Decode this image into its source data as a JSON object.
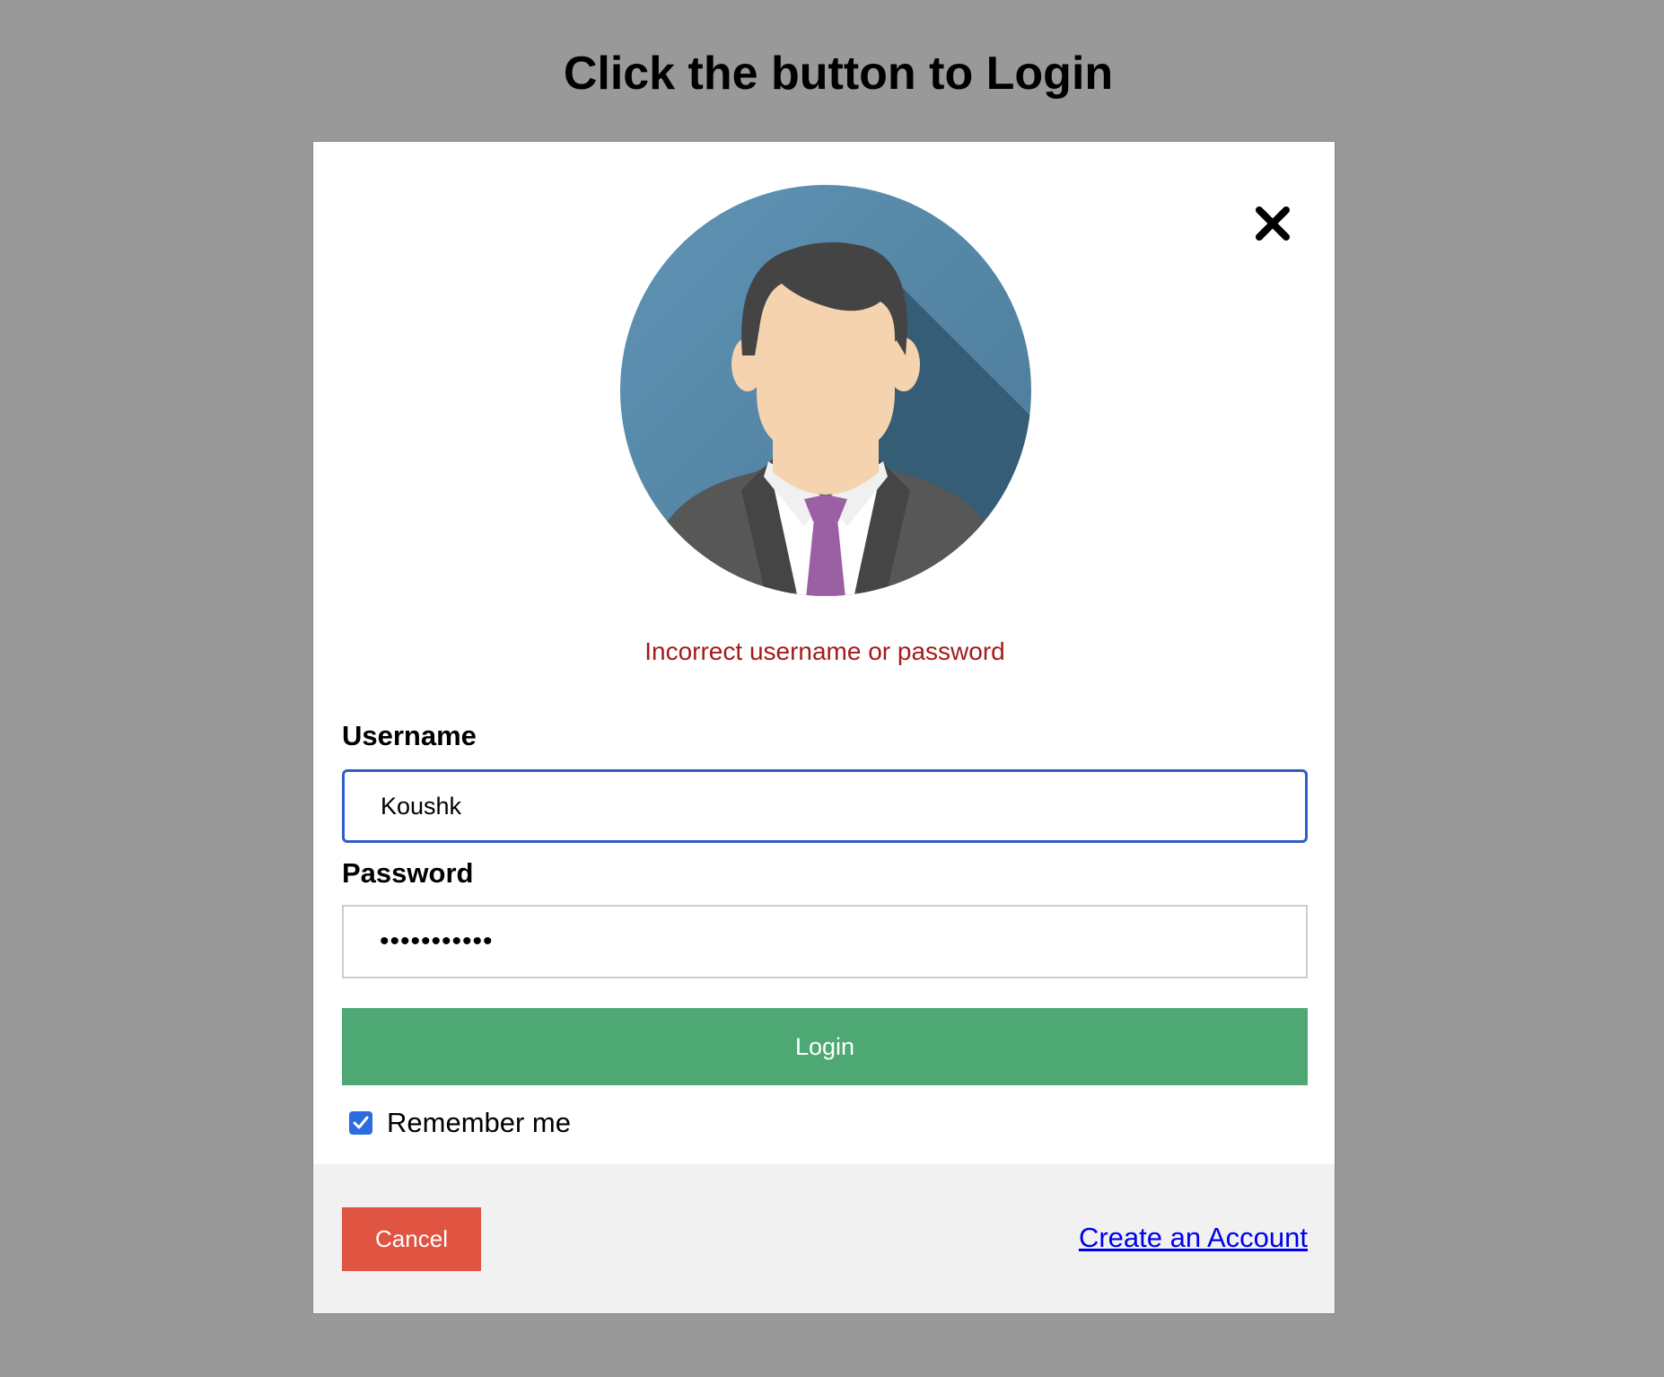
{
  "page": {
    "title": "Click the button to Login"
  },
  "modal": {
    "error_message": "Incorrect username or password",
    "username": {
      "label": "Username",
      "value": "Koushk"
    },
    "password": {
      "label": "Password",
      "masked_value": "•••••••••••"
    },
    "login_label": "Login",
    "remember": {
      "label": "Remember me",
      "checked": true
    },
    "footer": {
      "cancel_label": "Cancel",
      "create_account_label": "Create an Account"
    },
    "icons": {
      "close": "close-icon",
      "avatar": "user-avatar-icon",
      "checkbox": "checkmark-icon"
    }
  },
  "colors": {
    "page_background": "#999999",
    "error_text": "#a51a1a",
    "focus_border": "#2d5fc7",
    "login_button": "#4ea874",
    "cancel_button": "#e05442",
    "link": "#0000ee",
    "footer_background": "#f1f1f1",
    "avatar_background": "#5a88a8"
  }
}
